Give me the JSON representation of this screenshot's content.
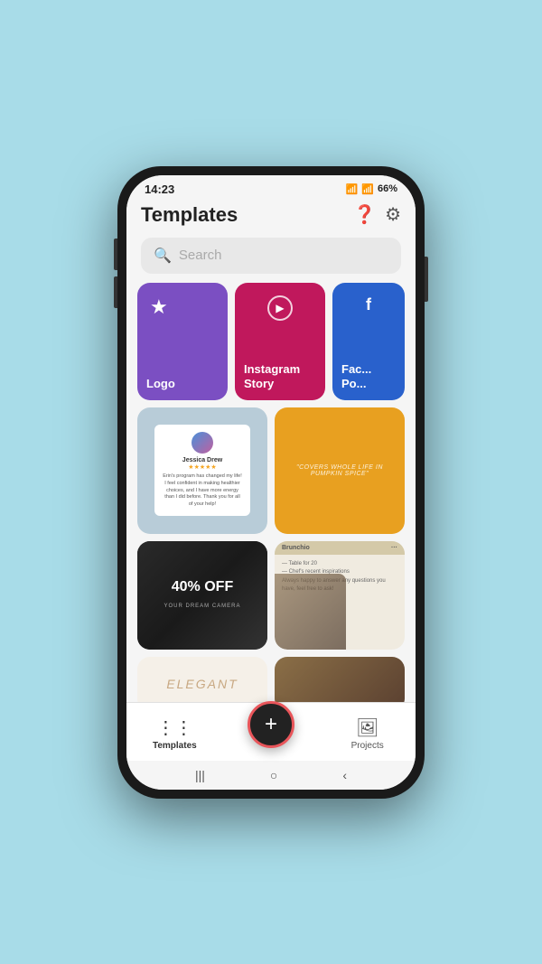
{
  "status": {
    "time": "14:23",
    "wifi": "WiFi",
    "signal": "signal",
    "battery": "66%"
  },
  "header": {
    "title": "Templates",
    "help_label": "?",
    "settings_label": "⚙"
  },
  "search": {
    "placeholder": "Search"
  },
  "template_cards": [
    {
      "id": "logo",
      "label": "Logo",
      "color": "#7b4fc2"
    },
    {
      "id": "instagram-story",
      "label": "Instagram Story",
      "color": "#c0185c"
    },
    {
      "id": "facebook-post",
      "label": "Fac... Po...",
      "color": "#2961cc"
    }
  ],
  "testimonial": {
    "name": "Jessica Drew",
    "stars": "★★★★★",
    "text": "Erin's program has changed my life! I feel confident in making healthier choices, and I have more energy than I did before. Thank you for all of your help!"
  },
  "orange_quote": "\"COVERS WHOLE LIFE IN PUMPKIN SPICE\"",
  "camera_card": {
    "discount": "40% OFF",
    "sub": "YOUR DREAM CAMERA"
  },
  "menu_card": {
    "title": "Brunchio",
    "subtitle": "Table for 20"
  },
  "elegant_text": "ELEGANT",
  "bottom_nav": {
    "templates_label": "Templates",
    "create_label": "+",
    "projects_label": "Projects"
  },
  "system_bar": {
    "back": "‹",
    "home": "○",
    "recents": "|||"
  }
}
